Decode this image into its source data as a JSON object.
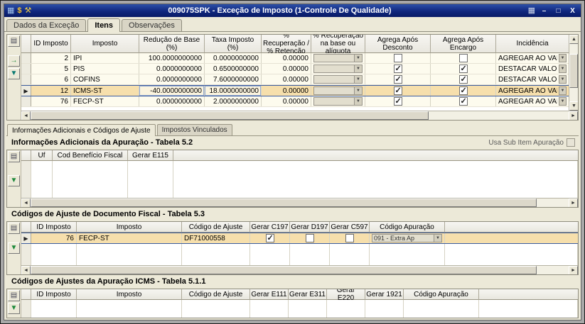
{
  "window": {
    "title": "009075SPK - Exceção de Imposto (1-Controle De Qualidade)"
  },
  "icons": {
    "grid": "▦",
    "money": "$",
    "wrench": "⚒",
    "app": "▦",
    "minimize": "–",
    "maximize": "□",
    "close": "X",
    "grid_tool": "▤",
    "export": "→",
    "go_last": "▼",
    "combo_arrow": "▼",
    "row_marker": "▶",
    "arrow_left": "◄",
    "arrow_right": "►",
    "arrow_up": "▲",
    "arrow_down": "▼"
  },
  "tabs": {
    "items": [
      {
        "label": "Dados da Exceção"
      },
      {
        "label": "Itens"
      },
      {
        "label": "Observações"
      }
    ],
    "active_index": 1
  },
  "main_grid": {
    "columns": [
      "ID Imposto",
      "Imposto",
      "Redução de Base (%)",
      "Taxa Imposto (%)",
      "% Recuperação / % Retenção",
      "% Recuperação na base ou alíquota",
      "Agrega Após Desconto",
      "Agrega Após Encargo",
      "Incidência"
    ],
    "rows": [
      {
        "id": "2",
        "imposto": "IPI",
        "reducao_base": "100.0000000000",
        "taxa": "0.0000000000",
        "recuperacao": "0.00000",
        "agrega_apos_desconto": false,
        "agrega_apos_encargo": false,
        "incidencia": "AGREGAR AO VALOR TO",
        "selected": false
      },
      {
        "id": "5",
        "imposto": "PIS",
        "reducao_base": "0.0000000000",
        "taxa": "0.6500000000",
        "recuperacao": "0.00000",
        "agrega_apos_desconto": true,
        "agrega_apos_encargo": true,
        "incidencia": "DESTACAR VALOR DO I",
        "selected": false
      },
      {
        "id": "6",
        "imposto": "COFINS",
        "reducao_base": "0.0000000000",
        "taxa": "7.6000000000",
        "recuperacao": "0.00000",
        "agrega_apos_desconto": true,
        "agrega_apos_encargo": true,
        "incidencia": "DESTACAR VALOR DO I",
        "selected": false
      },
      {
        "id": "12",
        "imposto": "ICMS-ST",
        "reducao_base": "-40.0000000000",
        "taxa": "18.0000000000",
        "recuperacao": "0.00000",
        "agrega_apos_desconto": true,
        "agrega_apos_encargo": true,
        "incidencia": "AGREGAR AO VALOR TO",
        "selected": true
      },
      {
        "id": "76",
        "imposto": "FECP-ST",
        "reducao_base": "0.0000000000",
        "taxa": "2.0000000000",
        "recuperacao": "0.00000",
        "agrega_apos_desconto": true,
        "agrega_apos_encargo": true,
        "incidencia": "AGREGAR AO VALOR TO",
        "selected": false
      }
    ]
  },
  "subtabs": {
    "items": [
      {
        "label": "Informações Adicionais e Códigos de Ajuste"
      },
      {
        "label": "Impostos Vinculados"
      }
    ],
    "active_index": 0
  },
  "section_apuracao": {
    "title": "Informações Adicionais da Apuração - Tabela 5.2",
    "usa_sub_item_label": "Usa Sub Item Apuração",
    "usa_sub_item_checked": false,
    "columns": [
      "Uf",
      "Cod Benefício Fiscal",
      "Gerar E115"
    ],
    "rows": []
  },
  "section_doc_fiscal": {
    "title": "Códigos de Ajuste de Documento Fiscal - Tabela 5.3",
    "columns": [
      "ID Imposto",
      "Imposto",
      "Código de Ajuste",
      "Gerar C197",
      "Gerar D197",
      "Gerar C597",
      "Código Apuração"
    ],
    "rows": [
      {
        "id": "76",
        "imposto": "FECP-ST",
        "codigo_ajuste": "DF71000558",
        "gerar_c197": true,
        "gerar_d197": false,
        "gerar_c597": false,
        "codigo_apuracao": "091 - Extra Ap",
        "selected": true
      }
    ]
  },
  "section_apuracao_icms": {
    "title": "Códigos de Ajustes da Apuração ICMS - Tabela 5.1.1",
    "columns": [
      "ID Imposto",
      "Imposto",
      "Código de Ajuste",
      "Gerar E111",
      "Gerar E311",
      "Gerar E220",
      "Gerar 1921",
      "Código Apuração"
    ],
    "rows": []
  }
}
